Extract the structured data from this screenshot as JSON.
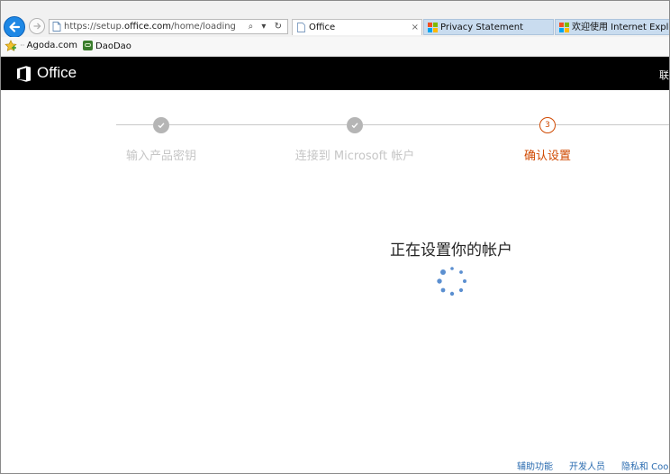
{
  "browser": {
    "address": {
      "url_prefix": "https://setup.",
      "url_domain": "office.com",
      "url_path": "/home/loading",
      "actions": "⌕ ▾ ↻"
    },
    "tabs": [
      {
        "label": "Office",
        "close": "×",
        "active": true
      },
      {
        "label": "Privacy Statement",
        "active": false
      },
      {
        "label": "欢迎使用 Internet Explorer",
        "active": false
      }
    ],
    "favorites": [
      {
        "label": "Agoda.com",
        "prefix": "···"
      },
      {
        "label": "DaoDao"
      }
    ]
  },
  "header": {
    "title": "Office",
    "right_text": "联"
  },
  "steps": [
    {
      "label": "输入产品密钥",
      "state": "done"
    },
    {
      "label": "连接到 Microsoft 帐户",
      "state": "done"
    },
    {
      "label": "确认设置",
      "number": "3",
      "state": "current"
    }
  ],
  "main": {
    "title": "正在设置你的帐户"
  },
  "footer": {
    "links": [
      "辅助功能",
      "开发人员",
      "隐私和 Cook"
    ]
  },
  "colors": {
    "accent": "#d04a02",
    "link": "#2b6cb0",
    "spinner": "#5b8fd0",
    "header_bg": "#000000"
  }
}
